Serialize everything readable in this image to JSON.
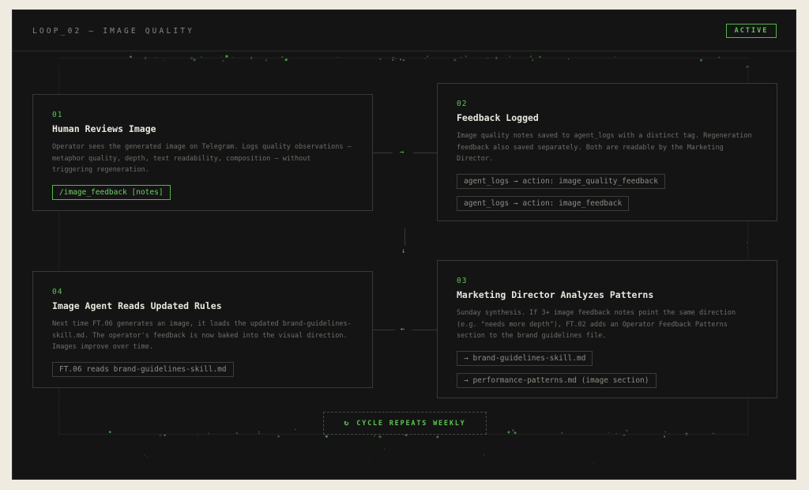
{
  "header": {
    "title": "LOOP_02 — IMAGE QUALITY",
    "status": "ACTIVE"
  },
  "colors": {
    "accent": "#5dc455",
    "background": "#141414",
    "page": "#efebe1",
    "border": "#383838"
  },
  "steps": [
    {
      "num": "01",
      "title": "Human Reviews Image",
      "desc": "Operator sees the generated image on Telegram. Logs quality observations — metaphor quality, depth, text readability, composition — without triggering regeneration.",
      "tags": [
        "/image_feedback [notes]"
      ]
    },
    {
      "num": "02",
      "title": "Feedback Logged",
      "desc": "Image quality notes saved to agent_logs with a distinct tag. Regeneration feedback also saved separately. Both are readable by the Marketing Director.",
      "tags": [
        "agent_logs → action: image_quality_feedback",
        "agent_logs → action: image_feedback"
      ]
    },
    {
      "num": "03",
      "title": "Marketing Director Analyzes Patterns",
      "desc": "Sunday synthesis. If 3+ image feedback notes point the same direction (e.g. \"needs more depth\"), FT.02 adds an Operator Feedback Patterns section to the brand guidelines file.",
      "tags": [
        "→ brand-guidelines-skill.md",
        "→ performance-patterns.md (image section)"
      ]
    },
    {
      "num": "04",
      "title": "Image Agent Reads Updated Rules",
      "desc": "Next time FT.06 generates an image, it loads the updated brand-guidelines-skill.md. The operator's feedback is now baked into the visual direction. Images improve over time.",
      "tags": [
        "FT.06 reads brand-guidelines-skill.md"
      ]
    }
  ],
  "arrows": {
    "right": "→",
    "down": "↓",
    "left": "←"
  },
  "cycle": {
    "icon": "↻",
    "label": "CYCLE REPEATS WEEKLY"
  }
}
